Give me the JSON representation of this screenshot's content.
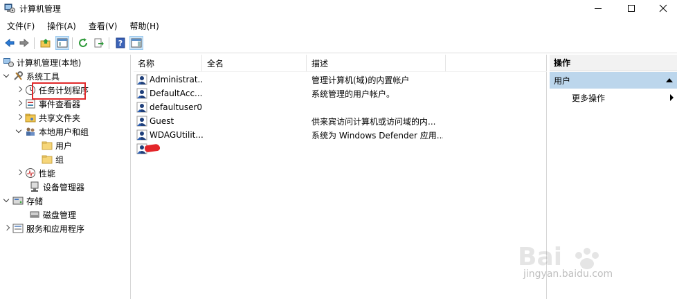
{
  "window": {
    "title": "计算机管理"
  },
  "menu": [
    "文件(F)",
    "操作(A)",
    "查看(V)",
    "帮助(H)"
  ],
  "tree": {
    "root": "计算机管理(本地)",
    "system_tools": "系统工具",
    "task_scheduler": "任务计划程序",
    "event_viewer": "事件查看器",
    "shared_folders": "共享文件夹",
    "local_users_groups": "本地用户和组",
    "users": "用户",
    "groups": "组",
    "performance": "性能",
    "device_manager": "设备管理器",
    "storage": "存储",
    "disk_management": "磁盘管理",
    "services_apps": "服务和应用程序"
  },
  "list": {
    "columns": [
      "名称",
      "全名",
      "描述"
    ],
    "rows": [
      {
        "name": "Administrat...",
        "full": "",
        "desc": "管理计算机(域)的内置帐户"
      },
      {
        "name": "DefaultAcc...",
        "full": "",
        "desc": "系统管理的用户帐户。"
      },
      {
        "name": "defaultuser0",
        "full": "",
        "desc": ""
      },
      {
        "name": "Guest",
        "full": "",
        "desc": "供来宾访问计算机或访问域的内..."
      },
      {
        "name": "WDAGUtilit...",
        "full": "",
        "desc": "系统为 Windows Defender 应用..."
      },
      {
        "name": "",
        "full": "",
        "desc": ""
      }
    ]
  },
  "actions": {
    "title": "操作",
    "section": "用户",
    "more": "更多操作"
  },
  "watermark": {
    "brand": "Baidu 经验",
    "url": "jingyan.baidu.com"
  }
}
